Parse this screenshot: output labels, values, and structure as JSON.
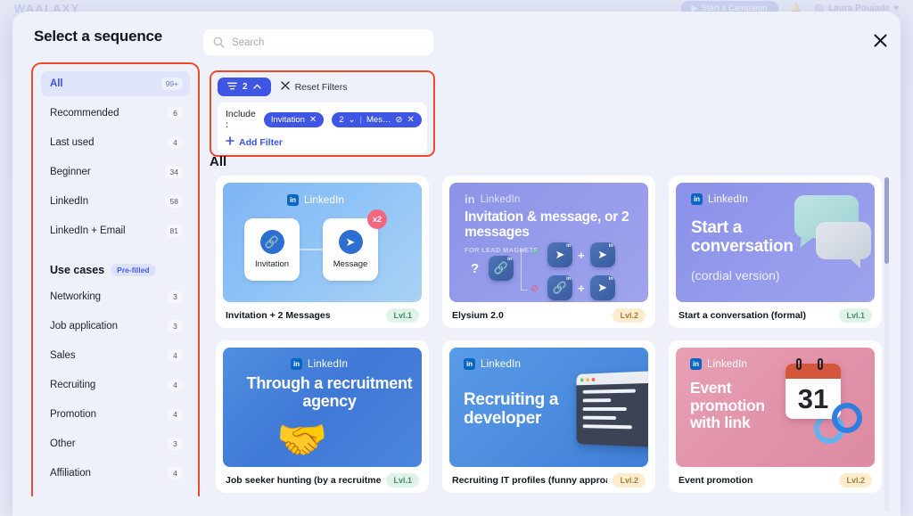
{
  "backdrop": {
    "logo": "WAALAXY",
    "campaign_button": "Start a Campaign",
    "bell_icon": "bell-icon",
    "user_name": "Laura Poujade",
    "chevron": "▾"
  },
  "modal": {
    "title": "Select a sequence",
    "close_icon": "close-icon"
  },
  "search": {
    "icon": "search-icon",
    "value": "",
    "placeholder": "Search"
  },
  "sidebar": {
    "items": [
      {
        "label": "All",
        "badge": "99+",
        "selected": true
      },
      {
        "label": "Recommended",
        "badge": "6",
        "selected": false
      },
      {
        "label": "Last used",
        "badge": "4",
        "selected": false
      },
      {
        "label": "Beginner",
        "badge": "34",
        "selected": false
      },
      {
        "label": "LinkedIn",
        "badge": "58",
        "selected": false
      },
      {
        "label": "LinkedIn + Email",
        "badge": "81",
        "selected": false
      }
    ],
    "section": {
      "title": "Use cases",
      "badge": "Pre-filled"
    },
    "use_cases": [
      {
        "label": "Networking",
        "badge": "3"
      },
      {
        "label": "Job application",
        "badge": "3"
      },
      {
        "label": "Sales",
        "badge": "4"
      },
      {
        "label": "Recruiting",
        "badge": "4"
      },
      {
        "label": "Promotion",
        "badge": "4"
      },
      {
        "label": "Other",
        "badge": "3"
      },
      {
        "label": "Affiliation",
        "badge": "4"
      }
    ]
  },
  "filters": {
    "toggle_icon": "filter-lines-icon",
    "toggle_count": "2",
    "toggle_chevron": "⌃",
    "reset_icon": "close-x-icon",
    "reset_label": "Reset Filters",
    "include_label": "Include :",
    "chips": [
      {
        "label": "Invitation",
        "remove_icon": "✕"
      },
      {
        "count": "2",
        "caret": "⌄",
        "divider": "|",
        "label": "Mes…",
        "block_icon": "⊘",
        "remove_icon": "✕"
      }
    ],
    "add_filter_label": "Add Filter",
    "add_filter_icon": "plus-icon"
  },
  "content": {
    "heading": "All",
    "cards": [
      {
        "id": "invitation-2-messages",
        "brand": "LinkedIn",
        "name": "Invitation + 2 Messages",
        "level": "Lvl.1",
        "level_class": "lvl-1",
        "node_1_label": "Invitation",
        "node_1_icon": "link-icon",
        "node_2_label": "Message",
        "node_2_icon": "send-icon",
        "repeat_badge": "x2"
      },
      {
        "id": "elysium-2",
        "brand": "LinkedIn",
        "name": "Elysium 2.0",
        "level": "Lvl.2",
        "level_class": "lvl-2",
        "art_title": "Invitation & message, or 2 messages",
        "art_subtitle": "FOR LEAD MAGNETS",
        "question_mark": "?",
        "check_icon": "✓",
        "block_icon": "⊘",
        "plus": "+"
      },
      {
        "id": "start-a-conversation",
        "brand": "LinkedIn",
        "name": "Start a conversation (formal)",
        "level": "Lvl.1",
        "level_class": "lvl-1",
        "art_title": "Start a conversation",
        "art_subtitle": "(cordial version)"
      },
      {
        "id": "job-seeker-hunting",
        "brand": "LinkedIn",
        "name": "Job seeker hunting (by a recruitment",
        "level": "Lvl.1",
        "level_class": "lvl-1",
        "art_title": "Through a recruitment agency",
        "art_emoji": "🤝"
      },
      {
        "id": "recruiting-it-profiles",
        "brand": "LinkedIn",
        "name": "Recruiting IT profiles (funny approach)",
        "level": "Lvl.2",
        "level_class": "lvl-2",
        "art_title": "Recruiting a developer"
      },
      {
        "id": "event-promotion",
        "brand": "LinkedIn",
        "name": "Event promotion",
        "level": "Lvl.2",
        "level_class": "lvl-2",
        "art_title": "Event promotion with link",
        "calendar_day": "31"
      }
    ]
  },
  "colors": {
    "accent_blue": "#3f55e3",
    "highlight_red": "#f0492a",
    "modal_bg": "#eef0fa",
    "linkedin_blue": "#0a66c2"
  }
}
